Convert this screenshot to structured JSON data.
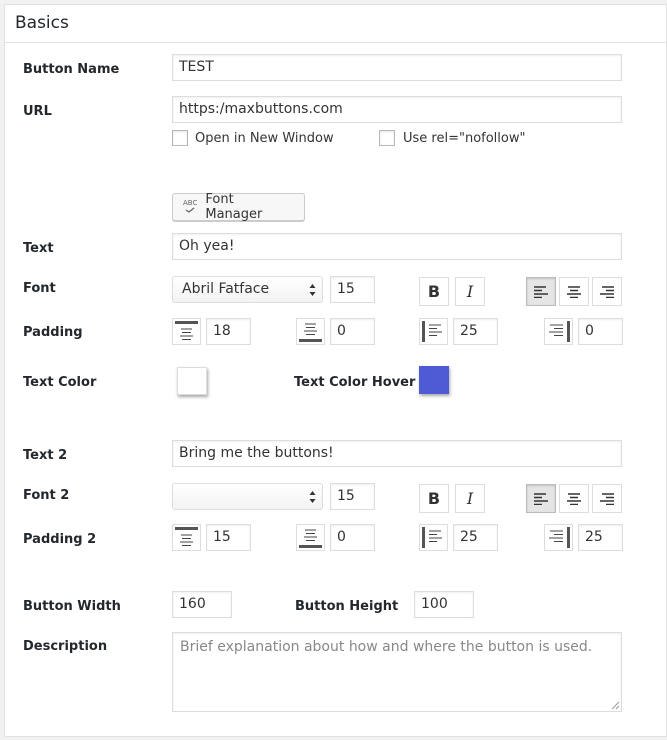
{
  "header": {
    "title": "Basics"
  },
  "fields": {
    "button_name": {
      "label": "Button Name",
      "value": "TEST"
    },
    "url": {
      "label": "URL",
      "value": "https:/maxbuttons.com"
    },
    "options": {
      "new_window": {
        "label": "Open in New Window",
        "checked": false
      },
      "nofollow": {
        "label": "Use rel=\"nofollow\"",
        "checked": false
      }
    },
    "font_manager": {
      "label": "Font Manager",
      "icon_text": "ABC"
    },
    "text": {
      "label": "Text",
      "value": "Oh yea!"
    },
    "font": {
      "label": "Font",
      "family": "Abril Fatface",
      "size": "15"
    },
    "padding": {
      "label": "Padding",
      "top": "18",
      "bottom": "0",
      "left": "25",
      "right": "0"
    },
    "text_color": {
      "label": "Text Color",
      "color": "#ffffff"
    },
    "text_color_hover": {
      "label": "Text Color Hover",
      "color": "#4f5bd5"
    },
    "text2": {
      "label": "Text 2",
      "value": "Bring me the buttons!"
    },
    "font2": {
      "label": "Font 2",
      "family": "",
      "size": "15"
    },
    "padding2": {
      "label": "Padding 2",
      "top": "15",
      "bottom": "0",
      "left": "25",
      "right": "25"
    },
    "button_width": {
      "label": "Button Width",
      "value": "160"
    },
    "button_height": {
      "label": "Button Height",
      "value": "100"
    },
    "description": {
      "label": "Description",
      "placeholder": "Brief explanation about how and where the button is used."
    }
  }
}
